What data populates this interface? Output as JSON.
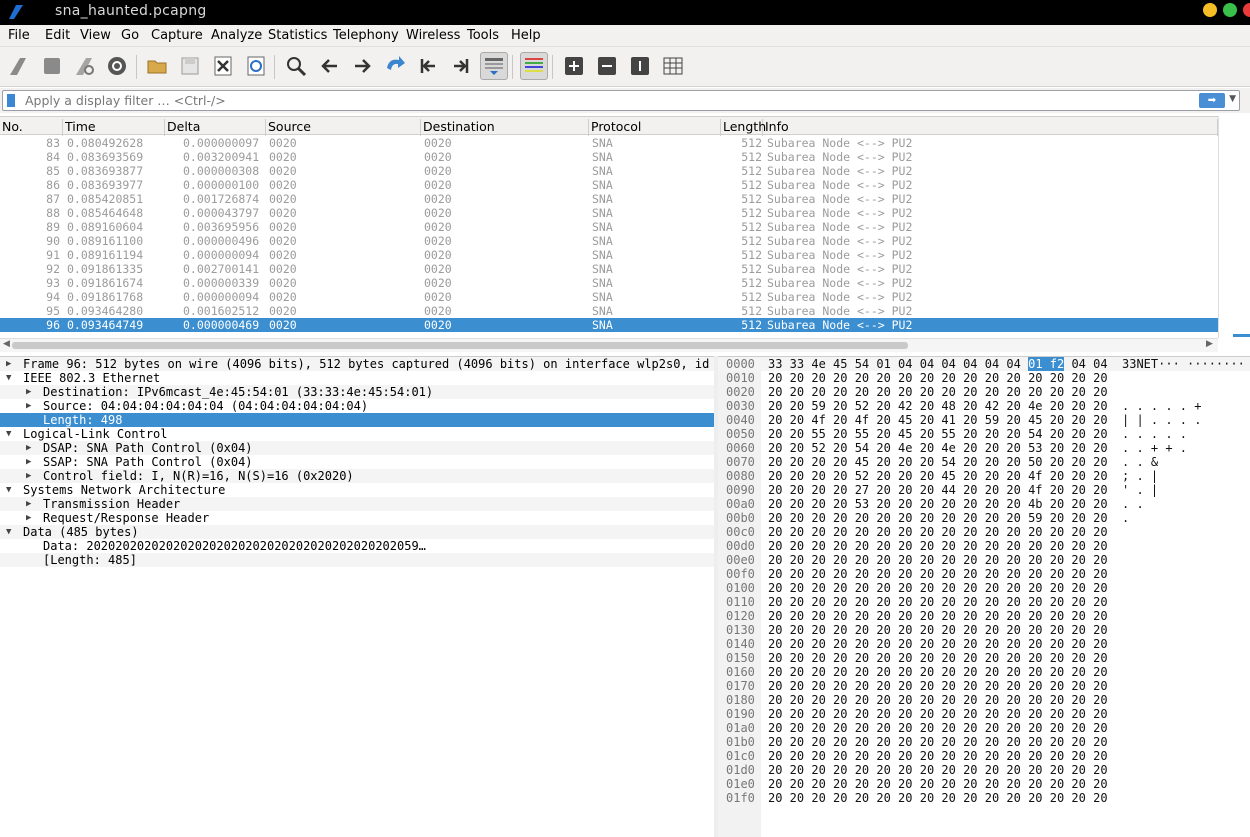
{
  "window": {
    "title": "sna_haunted.pcapng"
  },
  "menu": [
    "File",
    "Edit",
    "View",
    "Go",
    "Capture",
    "Analyze",
    "Statistics",
    "Telephony",
    "Wireless",
    "Tools",
    "Help"
  ],
  "filter": {
    "placeholder": "Apply a display filter … <Ctrl-/>"
  },
  "toolbar_icons": [
    "shark-fin-start-icon",
    "stop-icon",
    "restart-icon",
    "capture-options-icon",
    "open-folder-icon",
    "save-icon",
    "close-file-icon",
    "reload-icon",
    "find-icon",
    "back-arrow-icon",
    "forward-arrow-icon",
    "go-to-packet-icon",
    "first-packet-icon",
    "last-packet-icon",
    "autoscroll-icon",
    "colorize-icon",
    "zoom-in-icon",
    "zoom-out-icon",
    "normal-size-icon",
    "resize-columns-icon"
  ],
  "columns": [
    "No.",
    "Time",
    "Delta",
    "Source",
    "Destination",
    "Protocol",
    "Length",
    "Info"
  ],
  "packets": [
    {
      "no": "83",
      "time": "0.080492628",
      "delta": "0.000000097",
      "src": "0020",
      "dst": "0020",
      "proto": "SNA",
      "len": "512",
      "info": "Subarea Node <--> PU2"
    },
    {
      "no": "84",
      "time": "0.083693569",
      "delta": "0.003200941",
      "src": "0020",
      "dst": "0020",
      "proto": "SNA",
      "len": "512",
      "info": "Subarea Node <--> PU2"
    },
    {
      "no": "85",
      "time": "0.083693877",
      "delta": "0.000000308",
      "src": "0020",
      "dst": "0020",
      "proto": "SNA",
      "len": "512",
      "info": "Subarea Node <--> PU2"
    },
    {
      "no": "86",
      "time": "0.083693977",
      "delta": "0.000000100",
      "src": "0020",
      "dst": "0020",
      "proto": "SNA",
      "len": "512",
      "info": "Subarea Node <--> PU2"
    },
    {
      "no": "87",
      "time": "0.085420851",
      "delta": "0.001726874",
      "src": "0020",
      "dst": "0020",
      "proto": "SNA",
      "len": "512",
      "info": "Subarea Node <--> PU2"
    },
    {
      "no": "88",
      "time": "0.085464648",
      "delta": "0.000043797",
      "src": "0020",
      "dst": "0020",
      "proto": "SNA",
      "len": "512",
      "info": "Subarea Node <--> PU2"
    },
    {
      "no": "89",
      "time": "0.089160604",
      "delta": "0.003695956",
      "src": "0020",
      "dst": "0020",
      "proto": "SNA",
      "len": "512",
      "info": "Subarea Node <--> PU2"
    },
    {
      "no": "90",
      "time": "0.089161100",
      "delta": "0.000000496",
      "src": "0020",
      "dst": "0020",
      "proto": "SNA",
      "len": "512",
      "info": "Subarea Node <--> PU2"
    },
    {
      "no": "91",
      "time": "0.089161194",
      "delta": "0.000000094",
      "src": "0020",
      "dst": "0020",
      "proto": "SNA",
      "len": "512",
      "info": "Subarea Node <--> PU2"
    },
    {
      "no": "92",
      "time": "0.091861335",
      "delta": "0.002700141",
      "src": "0020",
      "dst": "0020",
      "proto": "SNA",
      "len": "512",
      "info": "Subarea Node <--> PU2"
    },
    {
      "no": "93",
      "time": "0.091861674",
      "delta": "0.000000339",
      "src": "0020",
      "dst": "0020",
      "proto": "SNA",
      "len": "512",
      "info": "Subarea Node <--> PU2"
    },
    {
      "no": "94",
      "time": "0.091861768",
      "delta": "0.000000094",
      "src": "0020",
      "dst": "0020",
      "proto": "SNA",
      "len": "512",
      "info": "Subarea Node <--> PU2"
    },
    {
      "no": "95",
      "time": "0.093464280",
      "delta": "0.001602512",
      "src": "0020",
      "dst": "0020",
      "proto": "SNA",
      "len": "512",
      "info": "Subarea Node <--> PU2"
    },
    {
      "no": "96",
      "time": "0.093464749",
      "delta": "0.000000469",
      "src": "0020",
      "dst": "0020",
      "proto": "SNA",
      "len": "512",
      "info": "Subarea Node <--> PU2",
      "selected": true
    }
  ],
  "details": [
    {
      "level": 0,
      "arrow": "collapsed",
      "text": "Frame 96: 512 bytes on wire (4096 bits), 512 bytes captured (4096 bits) on interface wlp2s0, id"
    },
    {
      "level": 0,
      "arrow": "expanded",
      "text": "IEEE 802.3 Ethernet"
    },
    {
      "level": 1,
      "arrow": "collapsed",
      "text": "Destination: IPv6mcast_4e:45:54:01 (33:33:4e:45:54:01)"
    },
    {
      "level": 1,
      "arrow": "collapsed",
      "text": "Source: 04:04:04:04:04:04 (04:04:04:04:04:04)"
    },
    {
      "level": 1,
      "arrow": "none",
      "text": "Length: 498",
      "selected": true
    },
    {
      "level": 0,
      "arrow": "expanded",
      "text": "Logical-Link Control"
    },
    {
      "level": 1,
      "arrow": "collapsed",
      "text": "DSAP: SNA Path Control (0x04)"
    },
    {
      "level": 1,
      "arrow": "collapsed",
      "text": "SSAP: SNA Path Control (0x04)"
    },
    {
      "level": 1,
      "arrow": "collapsed",
      "text": "Control field: I, N(R)=16, N(S)=16 (0x2020)"
    },
    {
      "level": 0,
      "arrow": "expanded",
      "text": "Systems Network Architecture"
    },
    {
      "level": 1,
      "arrow": "collapsed",
      "text": "Transmission Header"
    },
    {
      "level": 1,
      "arrow": "collapsed",
      "text": "Request/Response Header"
    },
    {
      "level": 0,
      "arrow": "expanded",
      "text": "Data (485 bytes)"
    },
    {
      "level": 1,
      "arrow": "none",
      "text": "Data: 2020202020202020202020202020202020202020202059…"
    },
    {
      "level": 1,
      "arrow": "none",
      "text": "[Length: 485]"
    }
  ],
  "bytes": [
    {
      "off": "0000",
      "hex": "33 33 4e 45 54 01 04 04  04 04 04 04 01 f2 04 04",
      "asc": "33NET··· ········",
      "hl_hex": "01 f2",
      "hl_asc": "··"
    },
    {
      "off": "0010",
      "hex": "20 20 20 20 20 20 20 20  20 20 20 20 20 20 20 20",
      "asc": ""
    },
    {
      "off": "0020",
      "hex": "20 20 20 20 20 20 20 20  20 20 20 20 20 20 20 20",
      "asc": ""
    },
    {
      "off": "0030",
      "hex": "20 20 59 20 52 20 42 20  48 20 42 20 4e 20 20 20",
      "asc": "  .  .  .   . . +"
    },
    {
      "off": "0040",
      "hex": "20 20 4f 20 4f 20 45 20  41 20 59 20 45 20 20 20",
      "asc": "  | |  .   . . ."
    },
    {
      "off": "0050",
      "hex": "20 20 55 20 55 20 45 20  55 20 20 20 54 20 20 20",
      "asc": "  .  .  .   .   ."
    },
    {
      "off": "0060",
      "hex": "20 20 52 20 54 20 4e 20  4e 20 20 20 53 20 20 20",
      "asc": "  . . +  +   ."
    },
    {
      "off": "0070",
      "hex": "20 20 20 20 45 20 20 20  54 20 20 20 50 20 20 20",
      "asc": "      .    .    &"
    },
    {
      "off": "0080",
      "hex": "20 20 20 20 52 20 20 20  45 20 20 20 4f 20 20 20",
      "asc": "      ;    .    |"
    },
    {
      "off": "0090",
      "hex": "20 20 20 20 27 20 20 20  44 20 20 20 4f 20 20 20",
      "asc": "      '    .    |"
    },
    {
      "off": "00a0",
      "hex": "20 20 20 20 53 20 20 20  20 20 20 20 4b 20 20 20",
      "asc": "      .         ."
    },
    {
      "off": "00b0",
      "hex": "20 20 20 20 20 20 20 20  20 20 20 20 59 20 20 20",
      "asc": "                ."
    },
    {
      "off": "00c0",
      "hex": "20 20 20 20 20 20 20 20  20 20 20 20 20 20 20 20",
      "asc": ""
    },
    {
      "off": "00d0",
      "hex": "20 20 20 20 20 20 20 20  20 20 20 20 20 20 20 20",
      "asc": ""
    },
    {
      "off": "00e0",
      "hex": "20 20 20 20 20 20 20 20  20 20 20 20 20 20 20 20",
      "asc": ""
    },
    {
      "off": "00f0",
      "hex": "20 20 20 20 20 20 20 20  20 20 20 20 20 20 20 20",
      "asc": ""
    },
    {
      "off": "0100",
      "hex": "20 20 20 20 20 20 20 20  20 20 20 20 20 20 20 20",
      "asc": ""
    },
    {
      "off": "0110",
      "hex": "20 20 20 20 20 20 20 20  20 20 20 20 20 20 20 20",
      "asc": ""
    },
    {
      "off": "0120",
      "hex": "20 20 20 20 20 20 20 20  20 20 20 20 20 20 20 20",
      "asc": ""
    },
    {
      "off": "0130",
      "hex": "20 20 20 20 20 20 20 20  20 20 20 20 20 20 20 20",
      "asc": ""
    },
    {
      "off": "0140",
      "hex": "20 20 20 20 20 20 20 20  20 20 20 20 20 20 20 20",
      "asc": ""
    },
    {
      "off": "0150",
      "hex": "20 20 20 20 20 20 20 20  20 20 20 20 20 20 20 20",
      "asc": ""
    },
    {
      "off": "0160",
      "hex": "20 20 20 20 20 20 20 20  20 20 20 20 20 20 20 20",
      "asc": ""
    },
    {
      "off": "0170",
      "hex": "20 20 20 20 20 20 20 20  20 20 20 20 20 20 20 20",
      "asc": ""
    },
    {
      "off": "0180",
      "hex": "20 20 20 20 20 20 20 20  20 20 20 20 20 20 20 20",
      "asc": ""
    },
    {
      "off": "0190",
      "hex": "20 20 20 20 20 20 20 20  20 20 20 20 20 20 20 20",
      "asc": ""
    },
    {
      "off": "01a0",
      "hex": "20 20 20 20 20 20 20 20  20 20 20 20 20 20 20 20",
      "asc": ""
    },
    {
      "off": "01b0",
      "hex": "20 20 20 20 20 20 20 20  20 20 20 20 20 20 20 20",
      "asc": ""
    },
    {
      "off": "01c0",
      "hex": "20 20 20 20 20 20 20 20  20 20 20 20 20 20 20 20",
      "asc": ""
    },
    {
      "off": "01d0",
      "hex": "20 20 20 20 20 20 20 20  20 20 20 20 20 20 20 20",
      "asc": ""
    },
    {
      "off": "01e0",
      "hex": "20 20 20 20 20 20 20 20  20 20 20 20 20 20 20 20",
      "asc": ""
    },
    {
      "off": "01f0",
      "hex": "20 20 20 20 20 20 20 20  20 20 20 20 20 20 20 20",
      "asc": ""
    }
  ],
  "colors": {
    "selection": "#3b8ed0",
    "win_yellow": "#f6be26",
    "win_green": "#39c04a",
    "win_red": "#ea3a3a"
  }
}
